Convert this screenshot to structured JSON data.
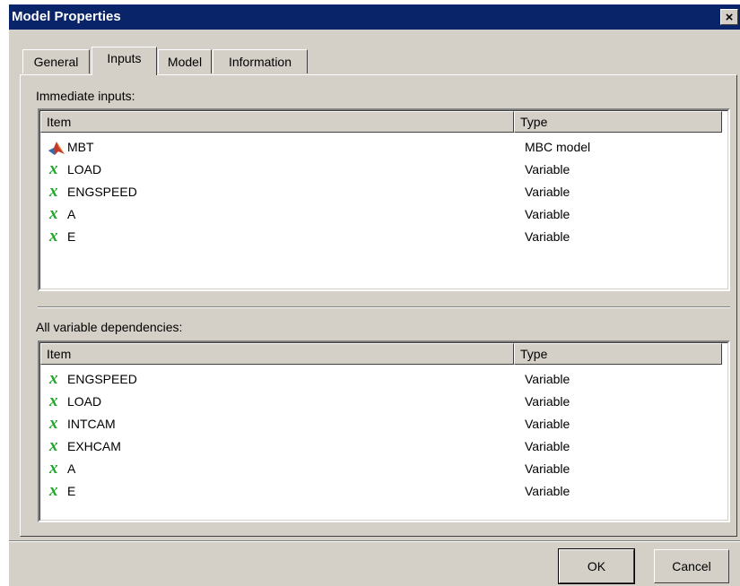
{
  "window": {
    "title": "Model Properties",
    "close_glyph": "×"
  },
  "tabs": [
    {
      "label": "General"
    },
    {
      "label": "Inputs"
    },
    {
      "label": "Model"
    },
    {
      "label": "Information"
    }
  ],
  "immediate": {
    "label": "Immediate inputs:",
    "columns": {
      "item": "Item",
      "type": "Type"
    },
    "rows": [
      {
        "icon": "matlab-model-icon",
        "name": "MBT",
        "type": "MBC model"
      },
      {
        "icon": "variable-x-icon",
        "name": "LOAD",
        "type": "Variable"
      },
      {
        "icon": "variable-x-icon",
        "name": "ENGSPEED",
        "type": "Variable"
      },
      {
        "icon": "variable-x-icon",
        "name": "A",
        "type": "Variable"
      },
      {
        "icon": "variable-x-icon",
        "name": "E",
        "type": "Variable"
      }
    ]
  },
  "dependencies": {
    "label": "All variable dependencies:",
    "columns": {
      "item": "Item",
      "type": "Type"
    },
    "rows": [
      {
        "icon": "variable-x-icon",
        "name": "ENGSPEED",
        "type": "Variable"
      },
      {
        "icon": "variable-x-icon",
        "name": "LOAD",
        "type": "Variable"
      },
      {
        "icon": "variable-x-icon",
        "name": "INTCAM",
        "type": "Variable"
      },
      {
        "icon": "variable-x-icon",
        "name": "EXHCAM",
        "type": "Variable"
      },
      {
        "icon": "variable-x-icon",
        "name": "A",
        "type": "Variable"
      },
      {
        "icon": "variable-x-icon",
        "name": "E",
        "type": "Variable"
      }
    ]
  },
  "icon_glyphs": {
    "variable": "x"
  },
  "buttons": {
    "ok": "OK",
    "cancel": "Cancel"
  },
  "colors": {
    "titlebar": "#0a246a",
    "variable_icon": "#22a52b",
    "dialog_face": "#d4d0c8"
  }
}
